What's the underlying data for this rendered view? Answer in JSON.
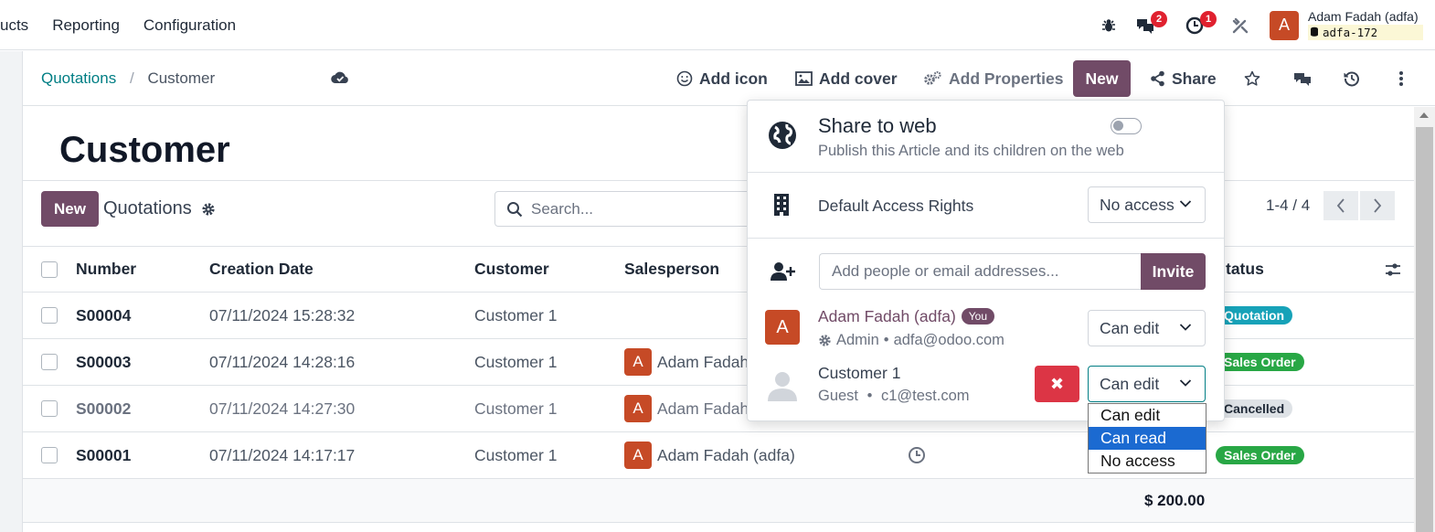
{
  "topbar": {
    "menu": [
      "ucts",
      "Reporting",
      "Configuration"
    ],
    "discuss_count": "2",
    "activity_count": "1",
    "user_initial": "A",
    "user_name": "Adam Fadah (adfa)",
    "db_name": "adfa-172"
  },
  "breadcrumb": {
    "parent": "Quotations",
    "separator": "/",
    "current": "Customer"
  },
  "toolbar": {
    "add_icon": "Add icon",
    "add_cover": "Add cover",
    "add_properties": "Add Properties",
    "new": "New",
    "share": "Share"
  },
  "page": {
    "title": "Customer",
    "new_button": "New",
    "list_title": "Quotations",
    "search_placeholder": "Search...",
    "pager": "1-4 / 4"
  },
  "table": {
    "headers": [
      "Number",
      "Creation Date",
      "Customer",
      "Salesperson",
      "Status"
    ],
    "header_status_visible": "tatus",
    "rows": [
      {
        "number": "S00004",
        "date": "07/11/2024 15:28:32",
        "customer": "Customer 1",
        "salesperson": "",
        "status": "Quotation",
        "status_color": "#17a2b8"
      },
      {
        "number": "S00003",
        "date": "07/11/2024 14:28:16",
        "customer": "Customer 1",
        "salesperson": "Adam Fadah",
        "status": "Sales Order",
        "status_color": "#28a745"
      },
      {
        "number": "S00002",
        "date": "07/11/2024 14:27:30",
        "customer": "Customer 1",
        "salesperson": "Adam Fadah",
        "status": "Cancelled",
        "status_color": "#dee2e6"
      },
      {
        "number": "S00001",
        "date": "07/11/2024 14:17:17",
        "customer": "Customer 1",
        "salesperson": "Adam Fadah (adfa)",
        "status": "Sales Order",
        "status_color": "#28a745"
      }
    ],
    "avatar_initial": "A",
    "total": "$ 200.00"
  },
  "share_popover": {
    "title": "Share to web",
    "subtitle": "Publish this Article and its children on the web",
    "default_access_label": "Default Access Rights",
    "default_access_value": "No access",
    "invite_placeholder": "Add people or email addresses...",
    "invite_button": "Invite",
    "members": [
      {
        "initial": "A",
        "name": "Adam Fadah (adfa)",
        "badge": "You",
        "role": "Admin",
        "email": "adfa@odoo.com",
        "permission": "Can edit"
      },
      {
        "name": "Customer 1",
        "role": "Guest",
        "email": "c1@test.com",
        "permission": "Can edit"
      }
    ],
    "dot": "•",
    "delete_glyph": "✖"
  },
  "permission_dropdown": {
    "options": [
      "Can edit",
      "Can read",
      "No access"
    ],
    "highlighted": "Can read"
  }
}
